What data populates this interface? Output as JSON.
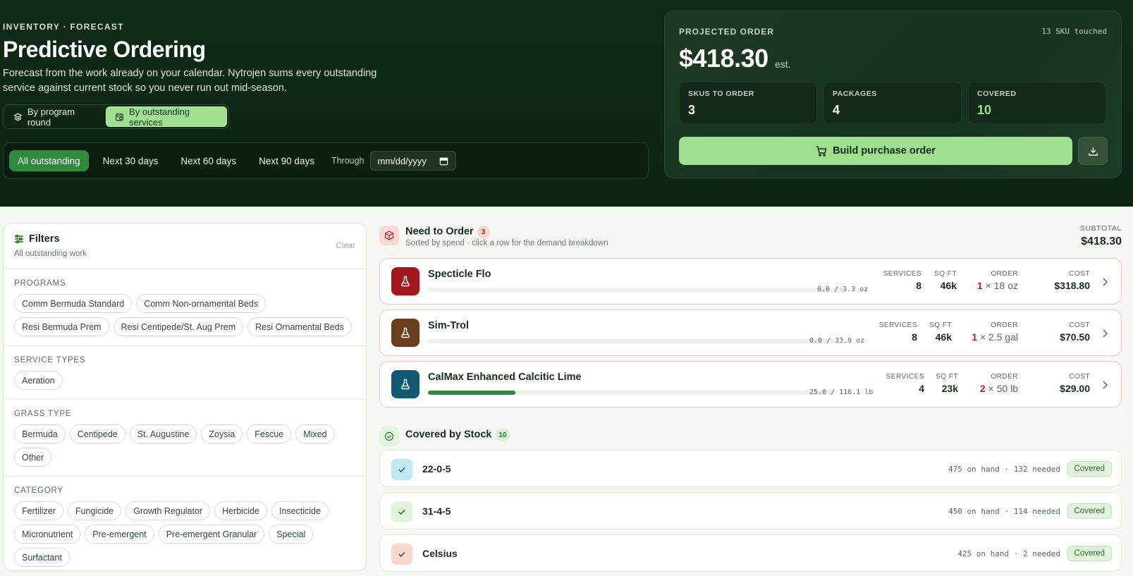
{
  "hero": {
    "eyebrow": "INVENTORY · FORECAST",
    "title": "Predictive Ordering",
    "description": "Forecast from the work already on your calendar. Nytrojen sums every outstanding service against current stock so you never run out mid-season.",
    "modes": [
      {
        "label": "By program round",
        "icon": "layers-icon",
        "active": false
      },
      {
        "label": "By outstanding services",
        "icon": "calendar-icon",
        "active": true
      }
    ],
    "ranges": [
      "All outstanding",
      "Next 30 days",
      "Next 60 days",
      "Next 90 days"
    ],
    "active_range": "All outstanding",
    "through_label": "Through",
    "date_placeholder": "mm/dd/yyyy"
  },
  "projected_order": {
    "label": "PROJECTED ORDER",
    "touched": "13 SKU touched",
    "amount": "$418.30",
    "est": "est.",
    "stats": [
      {
        "label": "SKUS TO ORDER",
        "value": "3",
        "highlight": false
      },
      {
        "label": "PACKAGES",
        "value": "4",
        "highlight": false
      },
      {
        "label": "COVERED",
        "value": "10",
        "highlight": true
      }
    ],
    "build_button": "Build purchase order",
    "accent": "#9ee08f"
  },
  "filters": {
    "title": "Filters",
    "subtitle": "All outstanding work",
    "clear": "Clear",
    "sections": [
      {
        "label": "PROGRAMS",
        "chips": [
          "Comm Bermuda Standard",
          "Comm Non-ornamental Beds",
          "Resi Bermuda Prem",
          "Resi Centipede/St. Aug Prem",
          "Resi Ornamental Beds"
        ]
      },
      {
        "label": "SERVICE TYPES",
        "chips": [
          "Aeration"
        ]
      },
      {
        "label": "GRASS TYPE",
        "chips": [
          "Bermuda",
          "Centipede",
          "St. Augustine",
          "Zoysia",
          "Fescue",
          "Mixed",
          "Other"
        ]
      },
      {
        "label": "CATEGORY",
        "chips": [
          "Fertilizer",
          "Fungicide",
          "Growth Regulator",
          "Herbicide",
          "Insecticide",
          "Micronutrient",
          "Pre-emergent",
          "Pre-emergent Granular",
          "Special",
          "Surfactant"
        ]
      }
    ]
  },
  "need_to_order": {
    "title": "Need to Order",
    "count": "3",
    "subtitle": "Sorted by spend · click a row for the demand breakdown",
    "subtotal_label": "SUBTOTAL",
    "subtotal": "$418.30",
    "col_labels": {
      "services": "SERVICES",
      "sqft": "SQ FT",
      "order": "ORDER",
      "cost": "COST"
    },
    "rows": [
      {
        "name": "Specticle Flo",
        "color": "#a3181c",
        "stock_text": "0.0 / 3.3 oz",
        "stock_fraction": 0.0,
        "services": "8",
        "sqft": "46k",
        "order_qty": "1",
        "order_unit": "× 18 oz",
        "cost": "$318.80"
      },
      {
        "name": "Sim-Trol",
        "color": "#6b3d1f",
        "stock_text": "0.0 / 33.9 oz",
        "stock_fraction": 0.0,
        "services": "8",
        "sqft": "46k",
        "order_qty": "1",
        "order_unit": "× 2.5 gal",
        "cost": "$70.50"
      },
      {
        "name": "CalMax Enhanced Calcitic Lime",
        "color": "#0f5a70",
        "stock_text": "25.0 / 116.1 lb",
        "stock_fraction": 0.215,
        "services": "4",
        "sqft": "23k",
        "order_qty": "2",
        "order_unit": "× 50 lb",
        "cost": "$29.00"
      }
    ]
  },
  "covered": {
    "title": "Covered by Stock",
    "count": "10",
    "rows": [
      {
        "name": "22-0-5",
        "meta": "475 on hand · 132 needed",
        "badge": "Covered",
        "icon_bg": "#bfe8f2"
      },
      {
        "name": "31-4-5",
        "meta": "450 on hand · 114 needed",
        "badge": "Covered",
        "icon_bg": "#e2f4da"
      },
      {
        "name": "Celsius",
        "meta": "425 on hand · 2 needed",
        "badge": "Covered",
        "icon_bg": "#fbd7d0"
      }
    ]
  }
}
